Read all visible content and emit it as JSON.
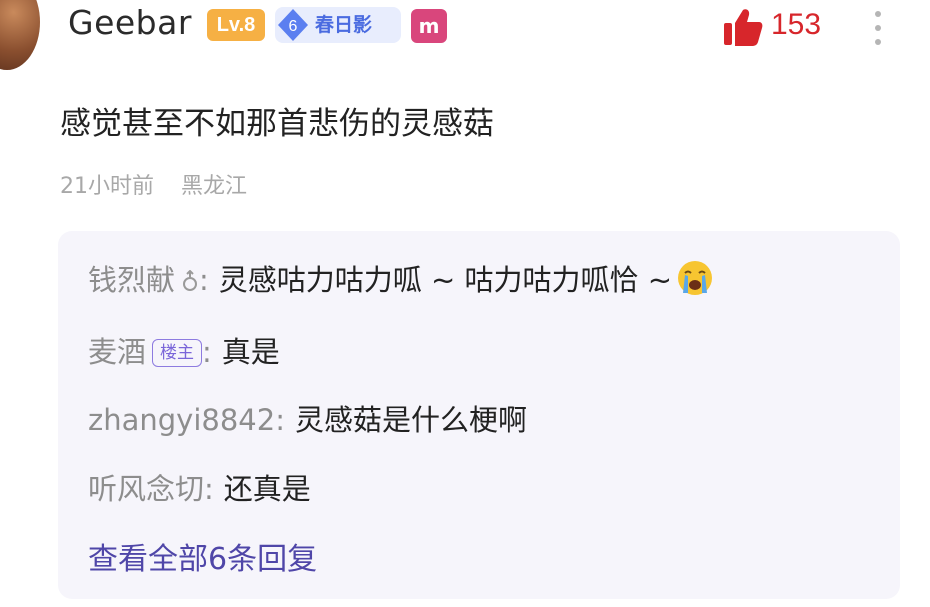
{
  "comment": {
    "username": "Geebar",
    "level_badge": "Lv.8",
    "fan_badge": {
      "level": "6",
      "name": "春日影"
    },
    "medal_text": "m",
    "likes": "153",
    "text": "感觉甚至不如那首悲伤的灵感菇",
    "time": "21小时前",
    "location": "黑龙江"
  },
  "replies": [
    {
      "author": "钱烈献",
      "gender_icon": "male-icon",
      "separator": ":",
      "text": "灵感咕力咕力呱 ~ 咕力咕力呱恰 ~",
      "emoji": "crying-face"
    },
    {
      "author": "麦酒",
      "tag": "楼主",
      "separator": ":",
      "text": "真是"
    },
    {
      "author": "zhangyi8842",
      "separator": ":",
      "text": "灵感菇是什么梗啊"
    },
    {
      "author": "听风念切",
      "separator": ":",
      "text": "还真是"
    }
  ],
  "view_all": "查看全部6条回复",
  "colors": {
    "like_red": "#d7262b",
    "level_orange": "#f6b044",
    "fan_blue": "#4a6be0",
    "medal_pink": "#d9467c",
    "link_purple": "#4f46a8",
    "reply_bg": "#f6f5fb"
  }
}
